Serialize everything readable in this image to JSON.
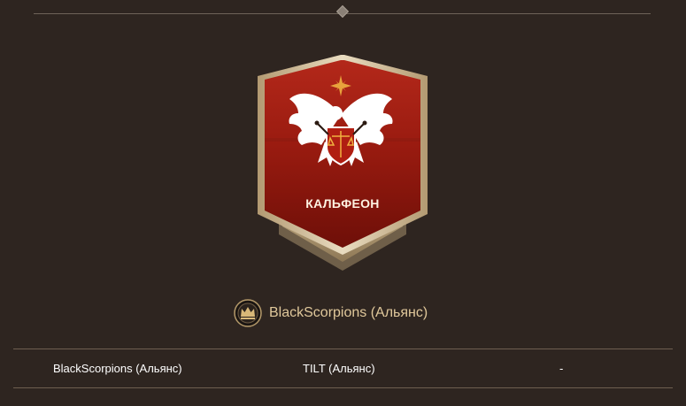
{
  "territory": {
    "name": "КАЛЬФЕОН"
  },
  "occupier": {
    "icon": "guild-crown-icon",
    "name": "BlackScorpions (Альянс)"
  },
  "table": {
    "rows": [
      [
        "BlackScorpions (Альянс)",
        "TILT (Альянс)",
        "-"
      ]
    ]
  },
  "colors": {
    "background": "#2e2520",
    "banner_red": "#9e1a10",
    "banner_frame": "#d9c7a4",
    "guild_text": "#e0c89b"
  }
}
